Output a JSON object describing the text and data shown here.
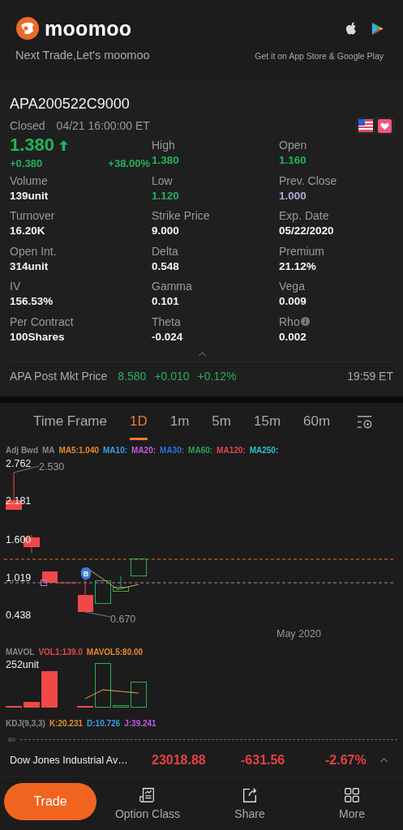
{
  "header": {
    "brand": "moomoo",
    "tagline": "Next Trade,Let's moomoo",
    "store_text": "Get it on App Store & Google Play"
  },
  "quote": {
    "symbol": "APA200522C9000",
    "status": "Closed",
    "time": "04/21 16:00:00 ET",
    "favorite": true,
    "price": "1.380",
    "rising": true,
    "change": "+0.380",
    "change_pct": "+38.00%",
    "stats": [
      {
        "label": "High",
        "value": "1.380",
        "color": "#22b35c"
      },
      {
        "label": "Open",
        "value": "1.160",
        "color": "#22b35c"
      },
      {
        "label": "Volume",
        "value": "139unit",
        "color": "#f2f2f2"
      },
      {
        "label": "Low",
        "value": "1.120",
        "color": "#22b35c"
      },
      {
        "label": "Prev. Close",
        "value": "1.000",
        "color": "#a9acd8"
      },
      {
        "label": "Turnover",
        "value": "16.20K",
        "color": "#f2f2f2"
      },
      {
        "label": "Strike Price",
        "value": "9.000",
        "color": "#f2f2f2"
      },
      {
        "label": "Exp. Date",
        "value": "05/22/2020",
        "color": "#f2f2f2"
      },
      {
        "label": "Open Int.",
        "value": "314unit",
        "color": "#f2f2f2"
      },
      {
        "label": "Delta",
        "value": "0.548",
        "color": "#f2f2f2"
      },
      {
        "label": "Premium",
        "value": "21.12%",
        "color": "#f2f2f2"
      },
      {
        "label": "IV",
        "value": "156.53%",
        "color": "#f2f2f2"
      },
      {
        "label": "Gamma",
        "value": "0.101",
        "color": "#f2f2f2"
      },
      {
        "label": "Vega",
        "value": "0.009",
        "color": "#f2f2f2"
      },
      {
        "label": "Per Contract",
        "value": "100Shares",
        "color": "#f2f2f2"
      },
      {
        "label": "Theta",
        "value": "-0.024",
        "color": "#f2f2f2"
      },
      {
        "label": "Rho",
        "value": "0.002",
        "color": "#f2f2f2",
        "info": true
      }
    ]
  },
  "post_market": {
    "label": "APA Post Mkt Price",
    "price": "8.580",
    "change": "+0.010",
    "change_pct": "+0.12%",
    "time": "19:59 ET"
  },
  "chart_tabs": [
    {
      "label": "Time Frame",
      "selected": false
    },
    {
      "label": "1D",
      "selected": true
    },
    {
      "label": "1m",
      "selected": false
    },
    {
      "label": "5m",
      "selected": false
    },
    {
      "label": "15m",
      "selected": false
    },
    {
      "label": "60m",
      "selected": false
    }
  ],
  "ma_legend": {
    "prefix": "Adj Bwd",
    "kind": "MA",
    "items": [
      {
        "label": "MA5:1.040",
        "color": "#e8892f"
      },
      {
        "label": "MA10:",
        "color": "#3a9ee0"
      },
      {
        "label": "MA20:",
        "color": "#c05ad8"
      },
      {
        "label": "MA30:",
        "color": "#2f6fe0"
      },
      {
        "label": "MA60:",
        "color": "#2fa24f"
      },
      {
        "label": "MA120:",
        "color": "#e04a4a"
      },
      {
        "label": "MA250:",
        "color": "#2ec4c4"
      }
    ]
  },
  "price_chart": {
    "y_labels": [
      "2.762",
      "2.181",
      "1.600",
      "1.019",
      "0.438"
    ],
    "high_label": "2.530",
    "low_label": "0.670",
    "marker": "B",
    "x_label": "May 2020"
  },
  "volume": {
    "prefix": "MAVOL",
    "items": [
      {
        "label": "VOL1:139.0",
        "color": "#e04a4a"
      },
      {
        "label": "MAVOL5:80.00",
        "color": "#e8892f"
      }
    ],
    "max_label": "252unit"
  },
  "kdj": {
    "prefix": "KDJ(9,3,3)",
    "items": [
      {
        "label": "K:20.231",
        "color": "#e8892f"
      },
      {
        "label": "D:10.726",
        "color": "#3a9ee0"
      },
      {
        "label": "J:39.241",
        "color": "#c05ad8"
      }
    ],
    "level_label": "80"
  },
  "index_bar": {
    "name": "Dow Jones Industrial Av…",
    "value": "23018.88",
    "change": "-631.56",
    "change_pct": "-2.67%",
    "rising": false
  },
  "bottom_nav": [
    {
      "label": "Trade",
      "kind": "button"
    },
    {
      "label": "Option Class",
      "kind": "option-class"
    },
    {
      "label": "Share",
      "kind": "share"
    },
    {
      "label": "More",
      "kind": "more"
    }
  ]
}
